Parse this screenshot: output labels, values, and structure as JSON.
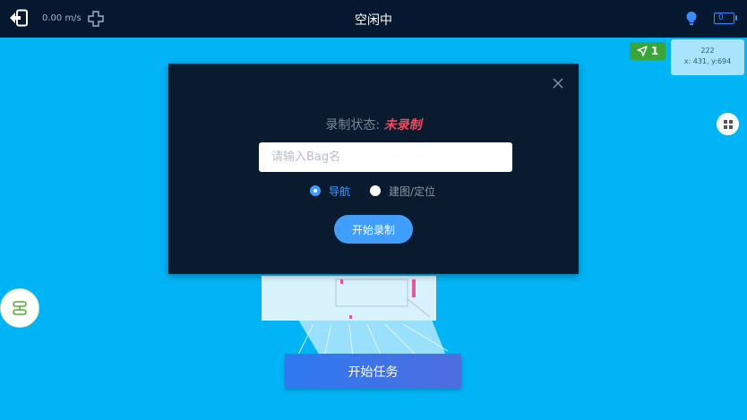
{
  "header": {
    "speed": "0.00 m/s",
    "title": "空闲中",
    "battery_level": "0"
  },
  "map": {
    "robot_badge_count": "1",
    "coord_line1": "222",
    "coord_line2": "x: 431, y:694",
    "start_task_label": "开始任务"
  },
  "modal": {
    "status_label": "录制状态:",
    "status_value": "未录制",
    "bag_placeholder": "请输入Bag名",
    "bag_value": "",
    "radio_options": [
      {
        "label": "导航",
        "selected": true
      },
      {
        "label": "建图/定位",
        "selected": false
      }
    ],
    "record_button_label": "开始录制"
  },
  "colors": {
    "topbar_bg": "#06182f",
    "map_bg": "#00b4f5",
    "modal_bg": "#0a1a2f",
    "accent": "#409eff",
    "status_red": "#f04a5a",
    "badge_green": "#3aa63a"
  },
  "icons": [
    "exit-icon",
    "dpad-icon",
    "bulb-icon",
    "battery-icon",
    "navigation-arrow-icon",
    "grid-menu-icon",
    "route-icon",
    "close-icon"
  ]
}
